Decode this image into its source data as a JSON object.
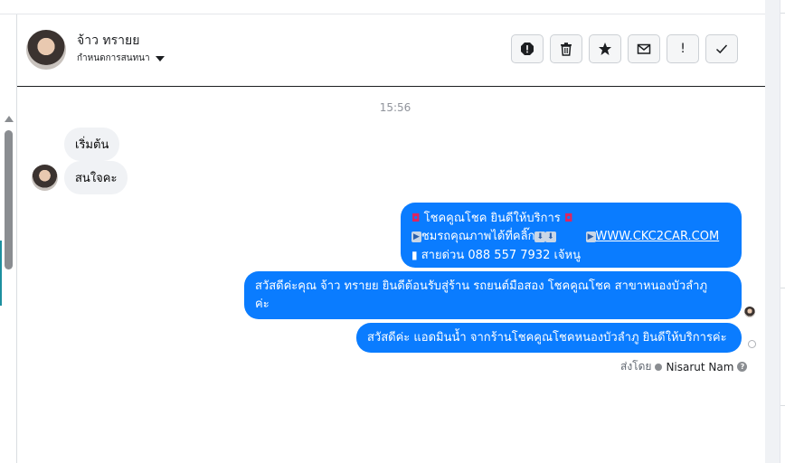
{
  "header": {
    "contact_name": "จ้าว ทรายย",
    "assign_label": "กำหนดการสนทนา"
  },
  "toolbar": {
    "icons": [
      "report-icon",
      "trash-icon",
      "star-icon",
      "mail-icon",
      "exclaim-icon",
      "check-icon"
    ],
    "exclaim_glyph": "!"
  },
  "conversation": {
    "timestamp": "15:56",
    "incoming": [
      {
        "text": "เริ่มต้น"
      },
      {
        "text": "สนใจคะ"
      }
    ],
    "auto_reply": {
      "line1": "โชคคูณโชค ยินดีให้บริการ",
      "line2": "ชมรถคุณภาพได้ที่คลิ๊ก",
      "link": "WWW.CKC2CAR.COM",
      "line3": "สายด่วน 088 557 7932 เจ้หนู"
    },
    "greeting": {
      "line1": "สวัสดีค่ะคุณ จ้าว ทรายย ยินดีต้อนรับสู่ร้าน รถยนต์มือสอง โชคคูณโชค สาขาหนองบัวลำภู",
      "line2": "ค่ะ"
    },
    "admin_message": "สวัสดีค่ะ แอดมินน้ำ จากร้านโชคคูณโชคหนองบัวลำภู ยินดีให้บริการค่ะ",
    "sent_by_label": "ส่งโดย",
    "sent_by_agent": "Nisarut Nam",
    "help_glyph": "?"
  },
  "colors": {
    "outgoing": "#0a7cff",
    "incoming": "#f0f2f5"
  }
}
